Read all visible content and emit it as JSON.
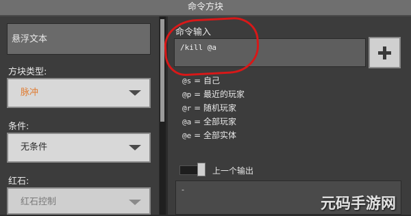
{
  "title": "命令方块",
  "left": {
    "hover_text_placeholder": "悬浮文本",
    "block_type_label": "方块类型:",
    "block_type_value": "脉冲",
    "condition_label": "条件:",
    "condition_value": "无条件",
    "redstone_label": "红石:",
    "redstone_value": "红石控制"
  },
  "command": {
    "label": "命令输入",
    "value": "/kill @a",
    "add_button_icon": "plus-icon"
  },
  "selectors": [
    {
      "code": "@s",
      "sep": "=",
      "desc": "自己"
    },
    {
      "code": "@p",
      "sep": "=",
      "desc": "最近的玩家"
    },
    {
      "code": "@r",
      "sep": "=",
      "desc": "随机玩家"
    },
    {
      "code": "@a",
      "sep": "=",
      "desc": "全部玩家"
    },
    {
      "code": "@e",
      "sep": "=",
      "desc": "全部实体"
    }
  ],
  "output": {
    "toggle_label": "上一个输出",
    "value": "-"
  },
  "watermark": "元码手游网",
  "colors": {
    "annotation": "#d81818",
    "block_type_text": "#e07a2e",
    "dropdown_text": "#2e2e2e",
    "redstone_text": "#7a7a7a"
  }
}
